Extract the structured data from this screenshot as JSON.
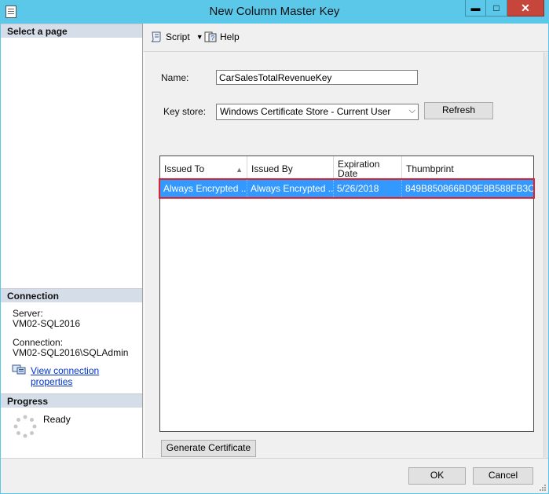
{
  "window": {
    "title": "New Column Master Key",
    "minimize": "▬",
    "maximize": "□",
    "close": "✕"
  },
  "left": {
    "select_page_heading": "Select a page",
    "connection_heading": "Connection",
    "server_label": "Server:",
    "server_value": "VM02-SQL2016",
    "connection_label": "Connection:",
    "connection_value": "VM02-SQL2016\\SQLAdmin",
    "view_connection_link": "View connection properties",
    "progress_heading": "Progress",
    "progress_status": "Ready"
  },
  "toolbar": {
    "script_label": "Script",
    "help_label": "Help"
  },
  "form": {
    "name_label": "Name:",
    "name_value": "CarSalesTotalRevenueKey",
    "keystore_label": "Key store:",
    "keystore_value": "Windows Certificate Store - Current User",
    "refresh_label": "Refresh",
    "generate_label": "Generate Certificate"
  },
  "grid": {
    "columns": [
      "Issued To",
      "Issued By",
      "Expiration\nDate",
      "Thumbprint"
    ],
    "column_line1": [
      "Issued To",
      "Issued By",
      "Expiration",
      "Thumbprint"
    ],
    "column_line2": [
      "",
      "",
      "Date",
      ""
    ],
    "rows": [
      {
        "issued_to": "Always Encrypted ...",
        "issued_by": "Always Encrypted ...",
        "expiration": "5/26/2018",
        "thumbprint": "849B850866BD9E8B588FB3C..."
      }
    ]
  },
  "footer": {
    "ok_label": "OK",
    "cancel_label": "Cancel"
  },
  "colors": {
    "title_bar": "#5bc8ea",
    "close_button": "#c7463c",
    "selected_row": "#3399ff",
    "highlight_border": "#e0202a"
  }
}
